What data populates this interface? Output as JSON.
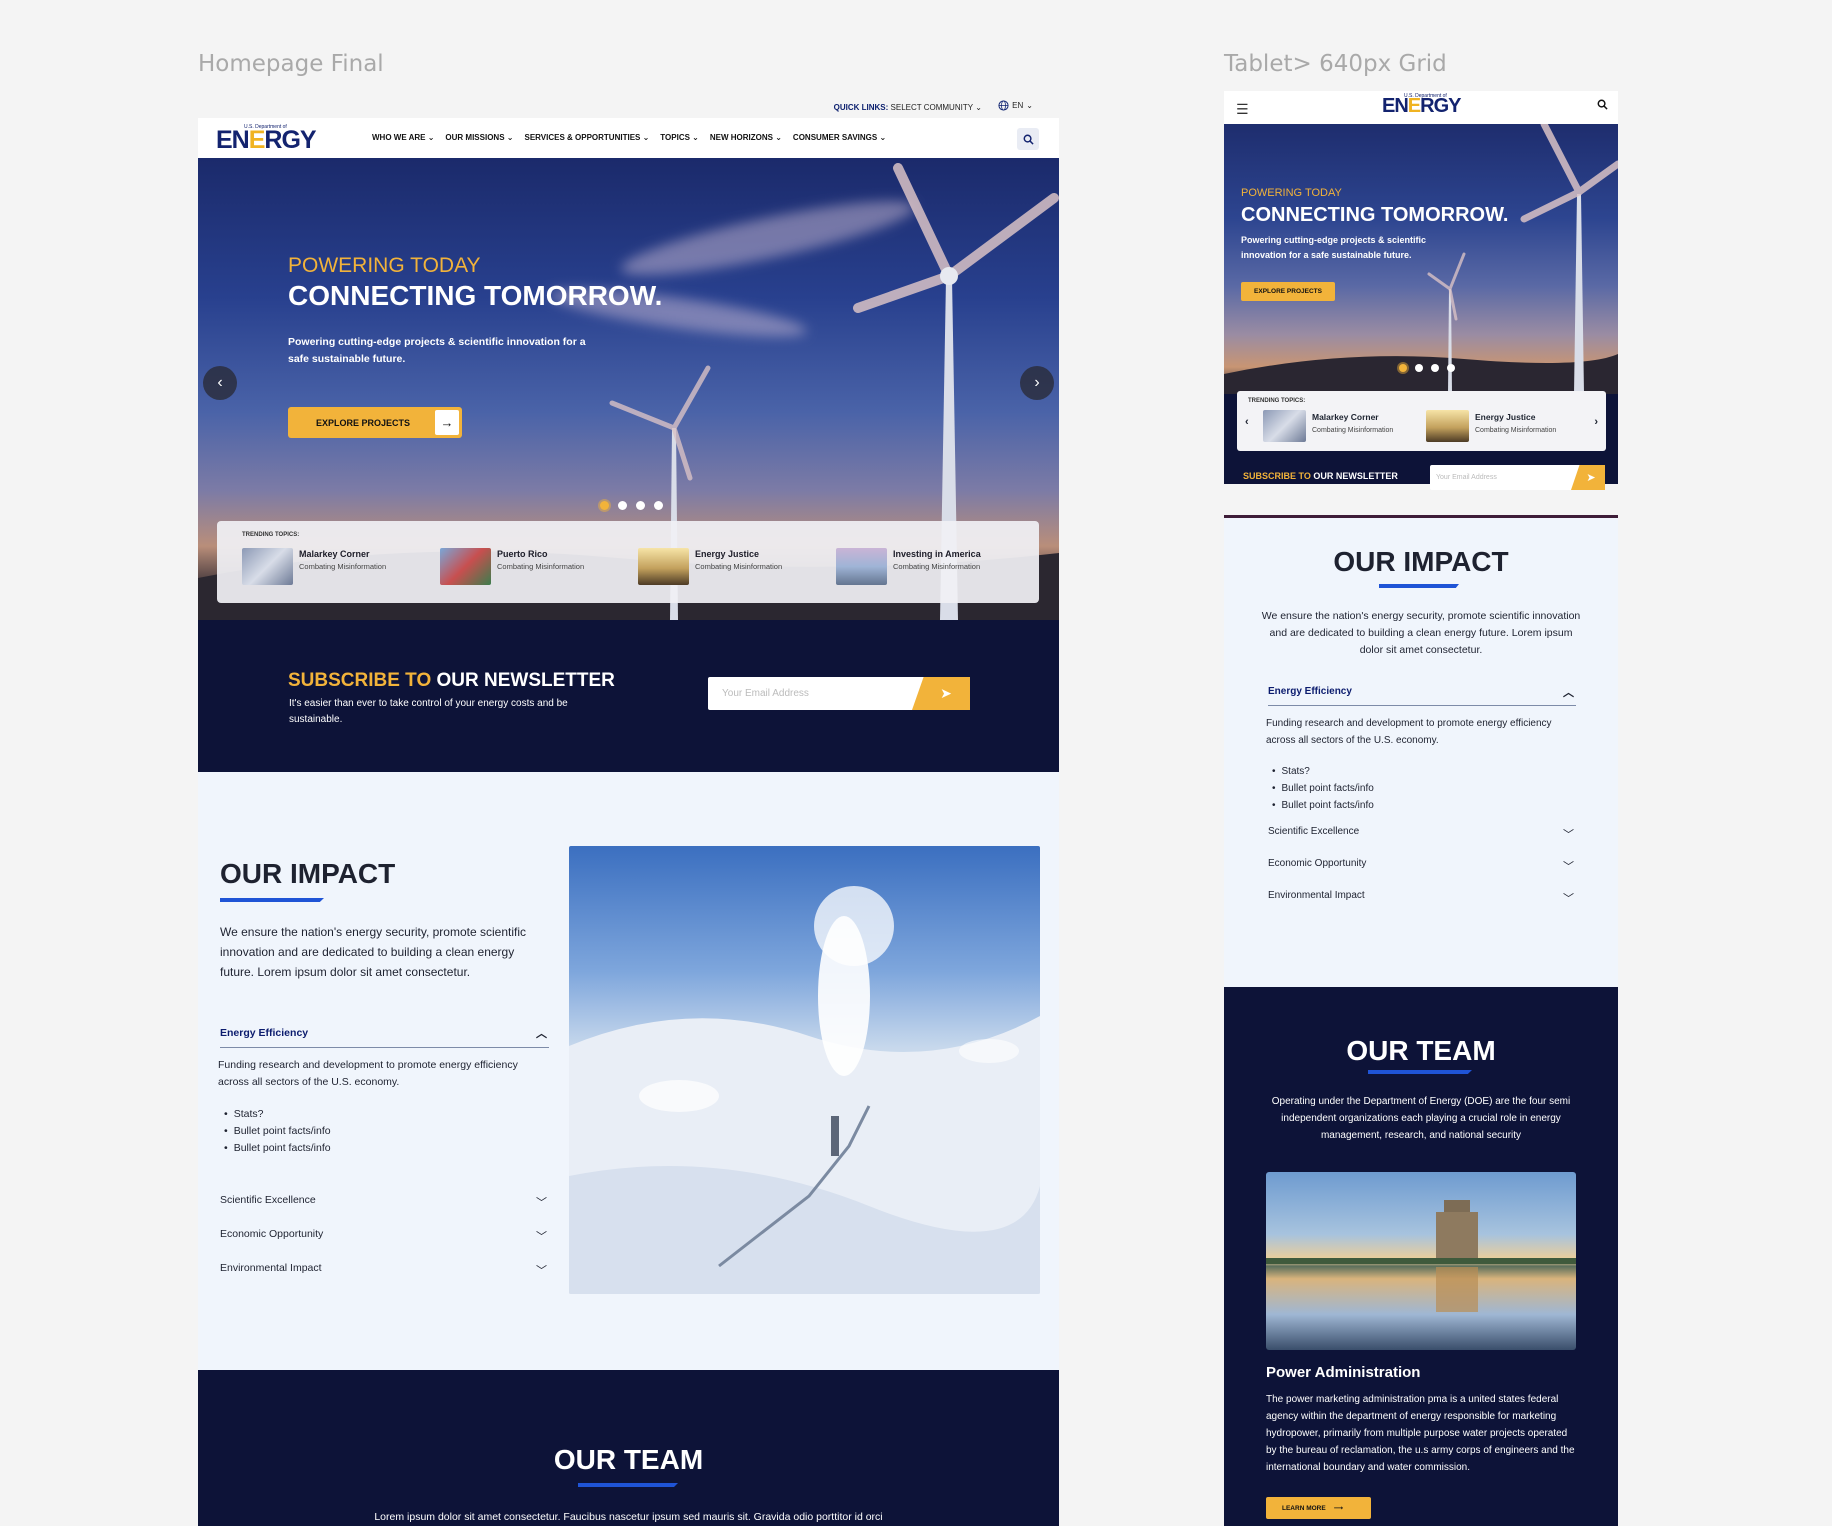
{
  "frames": {
    "desktop_label": "Homepage Final",
    "tablet_label": "Tablet> 640px Grid"
  },
  "colors": {
    "navy": "#0d1338",
    "accent": "#f2b33a",
    "link_blue": "#0c1c6e",
    "bar_blue": "#1f54d6",
    "impact_bg": "#f0f5fc"
  },
  "top_bar": {
    "quick_links_label": "QUICK LINKS:",
    "community_select": "SELECT COMMUNITY",
    "language": "EN"
  },
  "logo": {
    "small": "U.S. Department of",
    "word_1": "EN",
    "word_2": "E",
    "word_3": "RGY"
  },
  "nav": [
    {
      "label": "WHO WE ARE"
    },
    {
      "label": "OUR MISSIONS"
    },
    {
      "label": "SERVICES & OPPORTUNITIES"
    },
    {
      "label": "TOPICS"
    },
    {
      "label": "NEW HORIZONS"
    },
    {
      "label": "CONSUMER SAVINGS"
    }
  ],
  "hero": {
    "kicker": "POWERING TODAY",
    "headline": "CONNECTING TOMORROW.",
    "sub": "Powering cutting-edge projects & scientific innovation for a safe sustainable future.",
    "tablet_sub": "Powering cutting-edge projects & scientific innovation for a safe sustainable future.",
    "cta": "EXPLORE PROJECTS",
    "slides": 4,
    "active_slide": 1
  },
  "trending": {
    "label": "TRENDING TOPICS:",
    "items": [
      {
        "title": "Malarkey Corner",
        "desc": "Combating Misinformation"
      },
      {
        "title": "Puerto Rico",
        "desc": "Combating Misinformation"
      },
      {
        "title": "Energy Justice",
        "desc": "Combating Misinformation"
      },
      {
        "title": "Investing in America",
        "desc": "Combating Misinformation"
      }
    ]
  },
  "newsletter": {
    "heading_a": "SUBSCRIBE TO",
    "heading_b": "OUR NEWSLETTER",
    "text": "It's easier than ever to take control of your energy costs and be sustainable.",
    "placeholder": "Your Email Address"
  },
  "impact": {
    "heading": "OUR IMPACT",
    "text": "We ensure the nation's energy security, promote scientific innovation and are dedicated to building a clean energy future. Lorem ipsum dolor sit amet consectetur.",
    "open_item": {
      "title": "Energy Efficiency",
      "body": "Funding research and development to promote energy efficiency across all sectors of the U.S. economy.",
      "bullets": [
        "Stats?",
        "Bullet point facts/info",
        "Bullet point facts/info"
      ]
    },
    "closed_items": [
      "Scientific Excellence",
      "Economic Opportunity",
      "Environmental Impact"
    ]
  },
  "team": {
    "heading": "OUR TEAM",
    "desktop_text": "Lorem ipsum dolor sit amet consectetur. Faucibus nascetur ipsum sed mauris sit. Gravida odio porttitor id orci",
    "tablet_text": "Operating under the Department of Energy (DOE) are the four semi independent organizations each playing a crucial role in energy management, research, and national security",
    "card_title": "Power Administration",
    "card_text": "The power marketing administration pma is a united states federal agency within the department of energy responsible for marketing hydropower, primarily from multiple purpose water projects operated by the bureau of reclamation, the u.s army corps of engineers and the international boundary and water commission.",
    "card_cta": "LEARN MORE"
  }
}
